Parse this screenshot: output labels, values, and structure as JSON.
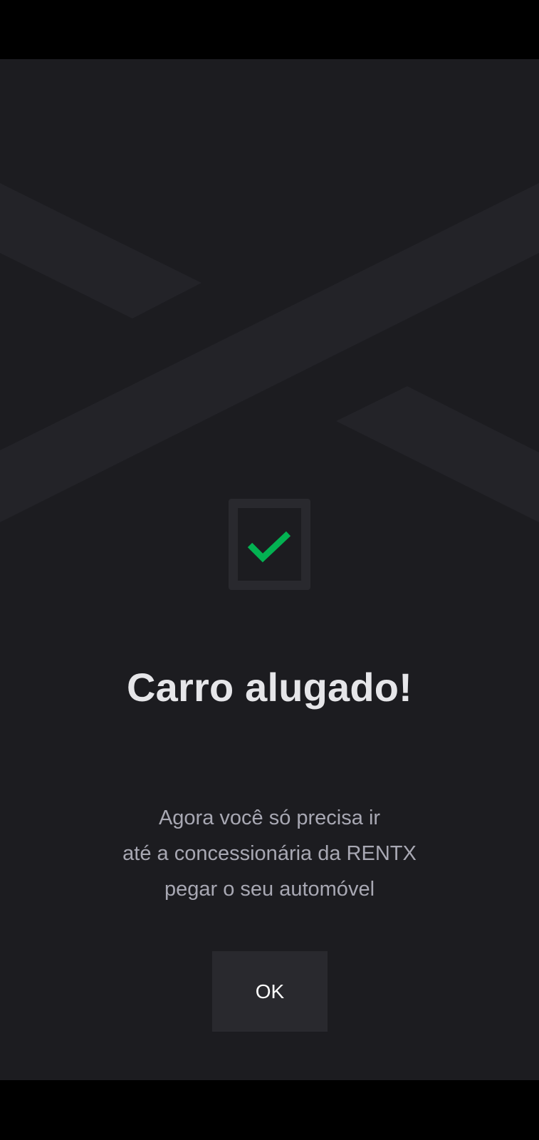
{
  "status_bar": {},
  "background": {
    "logo_icon": "rentx-x-logo-icon"
  },
  "success": {
    "icon": "check-icon",
    "accent_color": "#03b252",
    "title": "Carro alugado!",
    "message_lines": [
      "Agora você só precisa ir",
      "até a concessionária da RENTX",
      "pegar o seu automóvel"
    ]
  },
  "actions": {
    "ok_label": "OK"
  }
}
